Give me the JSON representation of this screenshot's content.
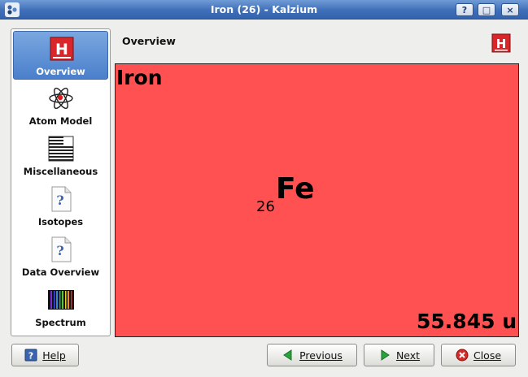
{
  "window": {
    "title": "Iron (26) - Kalzium",
    "help_glyph": "?",
    "maximize_glyph": "□",
    "close_glyph": "×"
  },
  "sidebar": {
    "items": [
      {
        "label": "Overview",
        "icon": "periodic-h-icon",
        "active": true
      },
      {
        "label": "Atom Model",
        "icon": "atom-icon",
        "active": false
      },
      {
        "label": "Miscellaneous",
        "icon": "misc-grid-icon",
        "active": false
      },
      {
        "label": "Isotopes",
        "icon": "help-document-icon",
        "active": false
      },
      {
        "label": "Data Overview",
        "icon": "help-document-icon",
        "active": false
      },
      {
        "label": "Spectrum",
        "icon": "spectrum-icon",
        "active": false
      }
    ]
  },
  "header": {
    "title": "Overview",
    "icon": "periodic-h-icon"
  },
  "element": {
    "name": "Iron",
    "number": "26",
    "symbol": "Fe",
    "mass": "55.845 u",
    "color": "#ff5151"
  },
  "buttons": {
    "help": "Help",
    "previous": "Previous",
    "next": "Next",
    "close": "Close"
  },
  "icon_glyphs": {
    "h_letter": "H",
    "question": "?"
  },
  "colors": {
    "titlebar": "#3f6fb8",
    "selection": "#4a7fcb",
    "element_bg": "#ff5151",
    "h_icon": "#d9262b"
  }
}
